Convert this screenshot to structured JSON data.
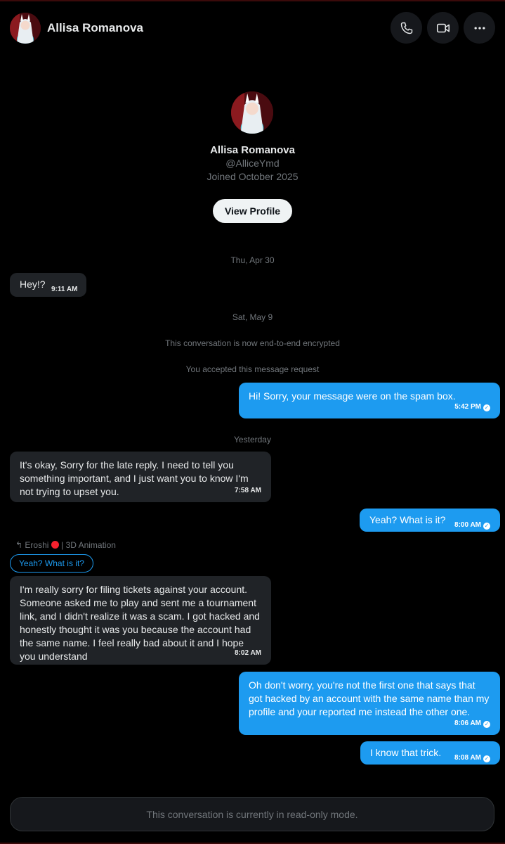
{
  "header": {
    "name": "Allisa Romanova",
    "buttons": [
      "phone-icon",
      "video-icon",
      "more-icon"
    ]
  },
  "profile": {
    "name": "Allisa Romanova",
    "handle": "@AlliceYmd",
    "joined": "Joined October 2025",
    "view_profile": "View Profile"
  },
  "conversation": {
    "date_1": "Thu, Apr 30",
    "date_2": "Sat, May 9",
    "encrypted_notice": "This conversation is now end-to-end encrypted",
    "accepted_notice": "You accepted this message request",
    "date_3": "Yesterday",
    "reply_author": "Eroshi",
    "reply_author_suffix": "| 3D Animation",
    "reply_quote": "Yeah? What is it?",
    "messages": [
      {
        "dir": "in",
        "text": "Hey!?",
        "time": "9:11 AM"
      },
      {
        "dir": "out",
        "text": "Hi! Sorry, your message were on the spam box.",
        "time": "5:42 PM"
      },
      {
        "dir": "in",
        "text": "It's okay, Sorry for the late reply. I need to tell you something important, and I just want you to know I'm not trying to upset you.",
        "time": "7:58 AM"
      },
      {
        "dir": "out",
        "text": "Yeah? What is it?",
        "time": "8:00 AM"
      },
      {
        "dir": "in",
        "text": "I'm really sorry for filing tickets against your account. Someone asked me to play and sent me a tournament link, and I didn't realize it was a scam. I got hacked and honestly thought it was you because the account had the same name. I feel really bad about it and I hope you understand",
        "time": "8:02 AM"
      },
      {
        "dir": "out",
        "text": "Oh don't worry, you're not the first one that says that got hacked by an account with the same name than my profile and your reported me instead the other one.",
        "time": "8:06 AM"
      },
      {
        "dir": "out",
        "text": "I know that trick.",
        "time": "8:08 AM"
      }
    ]
  },
  "footer": {
    "readonly": "This conversation is currently in read-only mode."
  },
  "colors": {
    "accent": "#1d9bf0",
    "incoming_bubble": "#202327",
    "background": "#000000"
  }
}
